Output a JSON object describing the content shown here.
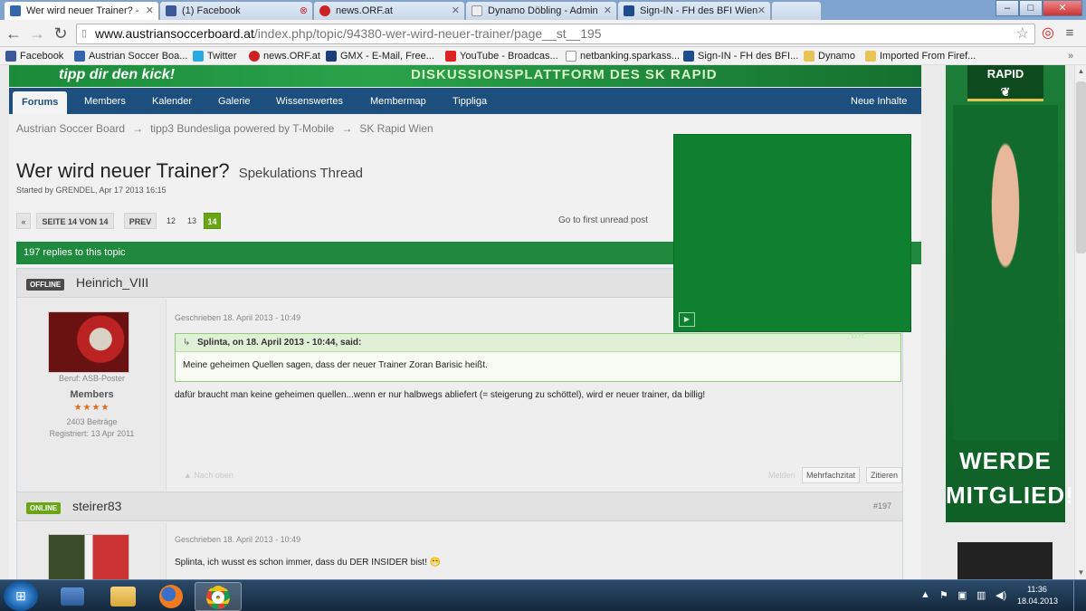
{
  "browser": {
    "tabs": [
      {
        "title": "Wer wird neuer Trainer? -",
        "favicon_color": "#3366aa",
        "active": true
      },
      {
        "title": "(1) Facebook",
        "favicon_color": "#3b5998",
        "active": false
      },
      {
        "title": "news.ORF.at",
        "favicon_color": "#cc2222",
        "active": false
      },
      {
        "title": "Dynamo Döbling - Admin",
        "favicon_color": "#eeeeee",
        "active": false
      },
      {
        "title": "Sign-IN - FH des BFI Wien",
        "favicon_color": "#1f4c8f",
        "active": false
      }
    ],
    "window_buttons": {
      "minimize": "–",
      "maximize": "□",
      "close": "✕"
    },
    "url_host": "www.austriansoccerboard.at",
    "url_path": "/index.php/topic/94380-wer-wird-neuer-trainer/page__st__195",
    "bookmarks": [
      {
        "label": "Facebook",
        "icon_color": "#3b5998"
      },
      {
        "label": "Austrian Soccer Boa...",
        "icon_color": "#3366aa"
      },
      {
        "label": "Twitter",
        "icon_color": "#29a9e0"
      },
      {
        "label": "news.ORF.at",
        "icon_color": "#cc2222"
      },
      {
        "label": "GMX - E-Mail, Free...",
        "icon_color": "#1c3f7a"
      },
      {
        "label": "YouTube - Broadcas...",
        "icon_color": "#dd2222"
      },
      {
        "label": "netbanking.sparkass...",
        "icon_color": "#cccccc"
      },
      {
        "label": "Sign-IN - FH des BFI...",
        "icon_color": "#1f4c8f"
      },
      {
        "label": "Dynamo",
        "icon_color": "#e8c35a"
      },
      {
        "label": "Imported From Firef...",
        "icon_color": "#e8c35a"
      }
    ]
  },
  "banner": {
    "tipp": "tipp dir den kick!",
    "diskussion": "DISKUSSIONSPLATTFORM DES SK RAPID"
  },
  "nav": {
    "items": [
      "Forums",
      "Members",
      "Kalender",
      "Galerie",
      "Wissenswertes",
      "Membermap",
      "Tippliga"
    ],
    "right": "Neue Inhalte"
  },
  "breadcrumb": [
    "Austrian Soccer Board",
    "tipp3 Bundesliga powered by T-Mobile",
    "SK Rapid Wien"
  ],
  "breadcrumb_sep": "→",
  "topic": {
    "title": "Wer wird neuer Trainer?",
    "subtitle": "Spekulations Thread",
    "started": "Started by GRENDEL, Apr 17 2013 16:15"
  },
  "pagination": {
    "first": "«",
    "page_label": "SEITE 14 VON 14",
    "prev": "PREV",
    "pages": [
      "12",
      "13"
    ],
    "current": "14",
    "first_unread": "Go to first unread post"
  },
  "replies": "197 replies to this topic",
  "posts": [
    {
      "status": "OFFLINE",
      "username": "Heinrich_VIII",
      "beruf": "Beruf: ASB-Poster",
      "group": "Members",
      "stars": "★★★★",
      "beitraege": "2403 Beiträge",
      "registriert": "Registriert: 13 Apr 2011",
      "date": "Geschrieben 18. April 2013 - 10:49",
      "quote_author": "Splinta, on 18. April 2013 - 10:44, said:",
      "quote_text": "Meine geheimen Quellen sagen, dass der neuer Trainer Zoran Barisic heißt.",
      "text": "dafür braucht man keine geheimen quellen...wenn er nur halbwegs abliefert (= steigerung zu schöttel), wird er neuer trainer, da billig!",
      "back_to_top": "▲ Nach oben",
      "melden": "Melden",
      "multiquote": "Mehrfachzitat",
      "quote_btn": "Zitieren"
    },
    {
      "status": "ONLINE",
      "username": "steirer83",
      "number": "#197",
      "date": "Geschrieben 18. April 2013 - 10:49",
      "text": "Splinta, ich wusst es schon immer, dass du DER INSIDER bist! 😁"
    }
  ],
  "sidebar_ad": {
    "club": "RAPID",
    "cta_line1": "WERDE",
    "cta_line2": "MITGLIED!"
  },
  "ad_play_icon": "▶",
  "taskbar": {
    "apps": [
      "windows-explorer",
      "file-explorer",
      "firefox",
      "chrome"
    ],
    "time": "11:36",
    "date": "18.04.2013"
  }
}
